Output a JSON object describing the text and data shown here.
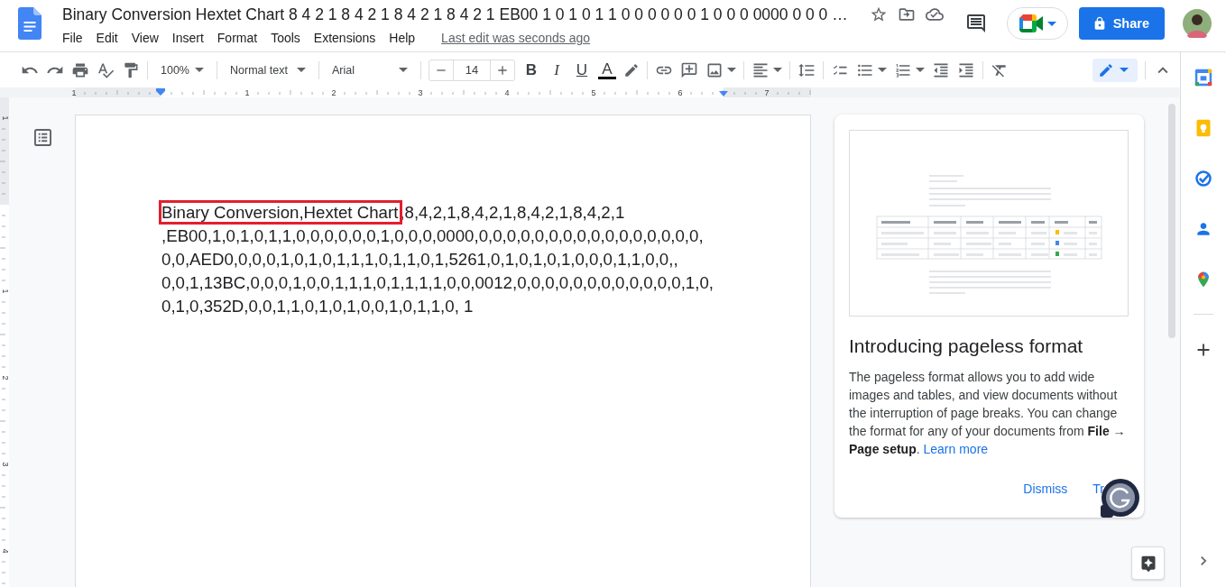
{
  "header": {
    "title": "Binary Conversion Hextet Chart 8 4 2 1 8 4 2 1 8 4 2 1 8 4 2 1 EB00 1 0 1 0 1 1 0 0 0 0 0 0 1 0 0 0 0000 0 0 0 …",
    "menu": [
      "File",
      "Edit",
      "View",
      "Insert",
      "Format",
      "Tools",
      "Extensions",
      "Help"
    ],
    "last_edit": "Last edit was seconds ago",
    "share": "Share"
  },
  "toolbar": {
    "zoom": "100%",
    "style": "Normal text",
    "font": "Arial",
    "font_size": "14",
    "format_buttons": [
      {
        "kind": "bold",
        "label": "B"
      },
      {
        "kind": "italic",
        "label": "I"
      },
      {
        "kind": "underline",
        "label": "U"
      },
      {
        "kind": "text_color",
        "label": "A"
      }
    ]
  },
  "ruler": {
    "horizontal": [
      "1",
      "1",
      "2",
      "3",
      "4",
      "5",
      "6",
      "7"
    ],
    "vertical": [
      "1",
      "1",
      "2",
      "3",
      "4"
    ]
  },
  "document": {
    "lines": [
      [
        {
          "text": "Binary Conversion,Hextet Chart",
          "boxed": true
        },
        {
          "text": ",8,4,2,1,8,4,2,1,8,4,2,1,8,4,2,1",
          "boxed": false
        }
      ],
      [
        {
          "text": ",EB00,1,0,1,0,1,1,0,0,0,0,0,0,1,0,0,0,0000,0,0,0,0,0,0,0,0,0,0,0,0,0,0,0,0,",
          "boxed": false
        }
      ],
      [
        {
          "text": "0,0,AED0,0,0,0,1,0,1,0,1,1,1,0,1,1,0,1,5261,0,1,0,1,0,1,0,0,0,1,1,0,0,,",
          "boxed": false
        }
      ],
      [
        {
          "text": "0,0,1,13BC,0,0,0,1,0,0,1,1,1,0,1,1,1,1,0,0,0012,0,0,0,0,0,0,0,0,0,0,0,0,1,0,",
          "boxed": false
        }
      ],
      [
        {
          "text": "0,1,0,352D,0,0,1,1,0,1,0,1,0,0,1,0,1,1,0, 1",
          "boxed": false
        }
      ]
    ]
  },
  "promo_card": {
    "title": "Introducing pageless format",
    "body": "The pageless format allows you to add wide images and tables, and view documents without the interruption of page breaks. You can change the format for any of your documents from **File → Page setup**.",
    "link": "Learn more",
    "actions": [
      "Dismiss",
      "Tr"
    ]
  }
}
